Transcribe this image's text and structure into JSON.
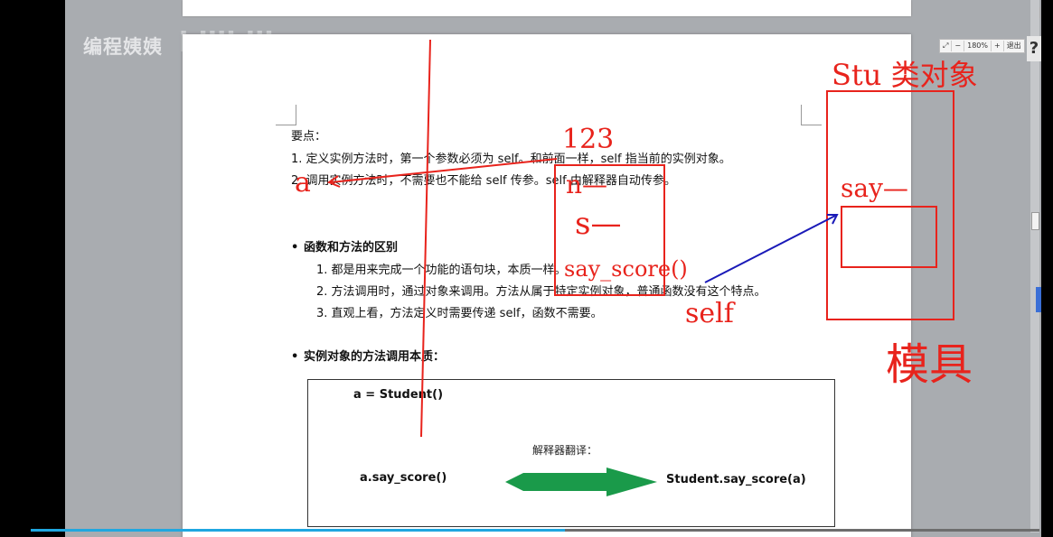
{
  "watermark": {
    "author": "编程姨姨",
    "site": "bilibili"
  },
  "toolbar": {
    "zoom": "180%",
    "minus": "−",
    "plus": "+",
    "exit": "退出"
  },
  "help_label": "?",
  "doc": {
    "points_title": "要点：",
    "point1": "1. 定义实例方法时，第一个参数必须为 self。和前面一样，self 指当前的实例对象。",
    "point2": "2. 调用实例方法时，不需要也不能给 self 传参。self 由解释器自动传参。",
    "section1_title": "函数和方法的区别",
    "section1_items": [
      "1.  都是用来完成一个功能的语句块，本质一样。",
      "2.  方法调用时，通过对象来调用。方法从属于特定实例对象，普通函数没有这个特点。",
      "3.  直观上看，方法定义时需要传递 self，函数不需要。"
    ],
    "section2_title": "实例对象的方法调用本质：",
    "code_assign": "a = Student()",
    "interpreter_label": "解释器翻译：",
    "code_call": "a.say_score()",
    "code_translated": "Student.say_score(a)"
  },
  "annotations": {
    "num": "123",
    "a_label": "a",
    "n_label": "n—",
    "s_label": "s—",
    "say_score": "say_score()",
    "self_label": "self",
    "stu_title": "Stu 类对象",
    "say_label": "say—",
    "mold": "模具"
  },
  "progress": {
    "fraction": 0.53
  },
  "colors": {
    "annotation_red": "#e8231c",
    "annotation_blue": "#1a1ab8",
    "arrow_green": "#1a9a4a",
    "progress": "#1fa7e0"
  }
}
